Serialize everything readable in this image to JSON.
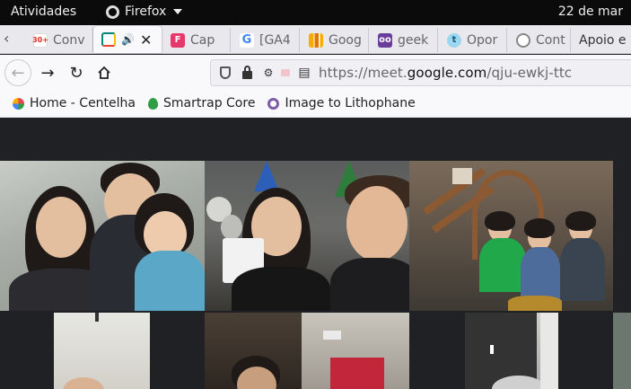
{
  "topbar": {
    "activities": "Atividades",
    "app_name": "Firefox",
    "date": "22 de mar"
  },
  "tabs": [
    {
      "title": "Conv",
      "favicon": "gmail-icon",
      "badge": "30+",
      "color": "#d93025"
    },
    {
      "title": "",
      "favicon": "meet-icon",
      "color": "#00897b",
      "active": true,
      "audio": "🔊",
      "close": "✕"
    },
    {
      "title": "Cap",
      "favicon": "figma-icon",
      "color": "#e8386b"
    },
    {
      "title": "[GA4",
      "favicon": "google-icon",
      "color": "#4285f4"
    },
    {
      "title": "Goog",
      "favicon": "analytics-icon",
      "color": "#f9ab00"
    },
    {
      "title": "geek",
      "favicon": "geek-icon",
      "color": "#6a3d9a"
    },
    {
      "title": "Opor",
      "favicon": "t-icon",
      "color": "#9bd7f0"
    },
    {
      "title": "Cont",
      "favicon": "cont-icon",
      "color": "#888888"
    },
    {
      "title": "Apoio e",
      "favicon": "",
      "color": "#e8e8ed"
    }
  ],
  "nav": {
    "url_prefix": "https://meet.",
    "url_domain": "google.com",
    "url_path": "/qju-ewkj-ttc"
  },
  "bookmarks": [
    {
      "label": "Home - Centelha",
      "icon": "centelha-icon",
      "color": "#e5484d"
    },
    {
      "label": "Smartrap Core",
      "icon": "leaf-icon",
      "color": "#2e9e44"
    },
    {
      "label": "Image to Lithophane",
      "icon": "lithophane-icon",
      "color": "#7b5ea7"
    }
  ]
}
